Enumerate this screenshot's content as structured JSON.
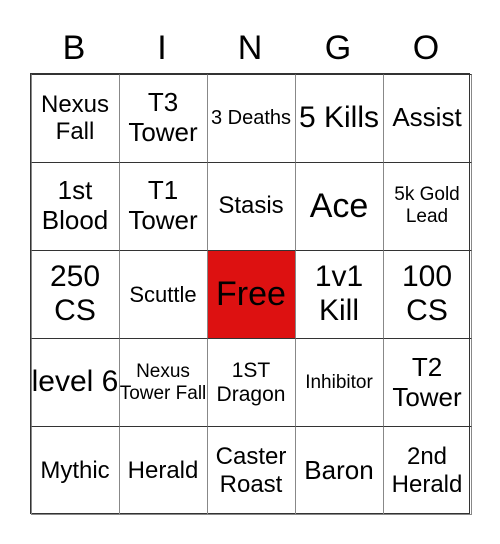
{
  "header": [
    "B",
    "I",
    "N",
    "G",
    "O"
  ],
  "free_color": "#DD1111",
  "cells": [
    {
      "text": "Nexus Fall",
      "size": 24
    },
    {
      "text": "T3 Tower",
      "size": 26
    },
    {
      "text": "3 Deaths",
      "size": 20
    },
    {
      "text": "5 Kills",
      "size": 30
    },
    {
      "text": "Assist",
      "size": 26
    },
    {
      "text": "1st Blood",
      "size": 26
    },
    {
      "text": "T1 Tower",
      "size": 26
    },
    {
      "text": "Stasis",
      "size": 24
    },
    {
      "text": "Ace",
      "size": 34
    },
    {
      "text": "5k Gold Lead",
      "size": 19
    },
    {
      "text": "250 CS",
      "size": 30
    },
    {
      "text": "Scuttle",
      "size": 22
    },
    {
      "text": "Free",
      "size": 34,
      "free": true
    },
    {
      "text": "1v1 Kill",
      "size": 30
    },
    {
      "text": "100 CS",
      "size": 30
    },
    {
      "text": "level 6",
      "size": 30
    },
    {
      "text": "Nexus Tower Fall",
      "size": 19
    },
    {
      "text": "1ST Dragon",
      "size": 21
    },
    {
      "text": "Inhibitor",
      "size": 19
    },
    {
      "text": "T2 Tower",
      "size": 26
    },
    {
      "text": "Mythic",
      "size": 24
    },
    {
      "text": "Herald",
      "size": 24
    },
    {
      "text": "Caster Roast",
      "size": 24
    },
    {
      "text": "Baron",
      "size": 26
    },
    {
      "text": "2nd Herald",
      "size": 24
    }
  ]
}
